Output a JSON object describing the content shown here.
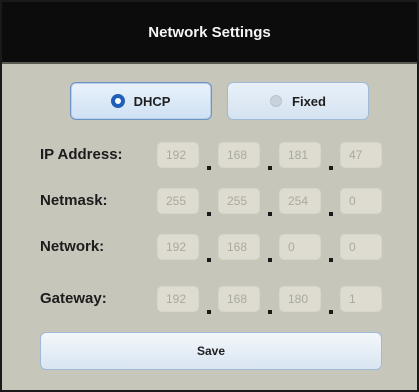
{
  "title": "Network Settings",
  "mode": {
    "options": [
      {
        "label": "DHCP",
        "selected": true
      },
      {
        "label": "Fixed",
        "selected": false
      }
    ]
  },
  "fields": [
    {
      "label": "IP Address:",
      "octets": [
        "192",
        "168",
        "181",
        "47"
      ]
    },
    {
      "label": "Netmask:",
      "octets": [
        "255",
        "255",
        "254",
        "0"
      ]
    },
    {
      "label": "Network:",
      "octets": [
        "192",
        "168",
        "0",
        "0"
      ]
    },
    {
      "label": "Gateway:",
      "octets": [
        "192",
        "168",
        "180",
        "1"
      ]
    }
  ],
  "save_label": "Save",
  "colors": {
    "background": "#c7c6bb",
    "titlebar": "#0c0c0c",
    "accent": "#1e5fb7"
  }
}
